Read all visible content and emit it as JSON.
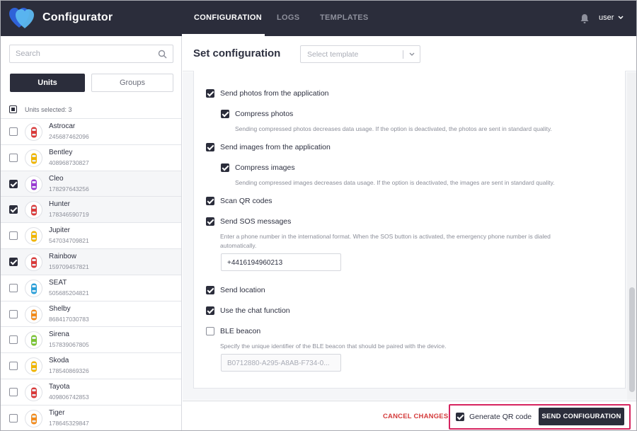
{
  "header": {
    "app_title": "Configurator",
    "tabs": [
      {
        "label": "CONFIGURATION",
        "active": true
      },
      {
        "label": "LOGS",
        "active": false
      },
      {
        "label": "TEMPLATES",
        "active": false
      }
    ],
    "user": "user",
    "icons": {
      "logo": "heart-logo-icon",
      "notifications": "bell-icon",
      "user_menu": "chevron-down-icon"
    },
    "colors": {
      "bar": "#2b2d3b",
      "logo_primary": "#2f62d8",
      "logo_secondary": "#5cb8f0"
    }
  },
  "sidebar": {
    "search_placeholder": "Search",
    "segments": {
      "units": "Units",
      "groups": "Groups",
      "active": "units"
    },
    "units_selected": "Units selected: 3",
    "units": [
      {
        "name": "Astrocar",
        "id": "245687462096",
        "checked": false,
        "color": "#d93a3a"
      },
      {
        "name": "Bentley",
        "id": "408968730827",
        "checked": false,
        "color": "#f0b400"
      },
      {
        "name": "Cleo",
        "id": "178297643256",
        "checked": true,
        "color": "#9b3bd1"
      },
      {
        "name": "Hunter",
        "id": "178346590719",
        "checked": true,
        "color": "#d93a3a"
      },
      {
        "name": "Jupiter",
        "id": "547034709821",
        "checked": false,
        "color": "#f0b400"
      },
      {
        "name": "Rainbow",
        "id": "159709457821",
        "checked": true,
        "color": "#d93a3a"
      },
      {
        "name": "SEAT",
        "id": "505685204821",
        "checked": false,
        "color": "#2a9fd8"
      },
      {
        "name": "Shelby",
        "id": "868417030783",
        "checked": false,
        "color": "#f28a1c"
      },
      {
        "name": "Sirena",
        "id": "157839067805",
        "checked": false,
        "color": "#7bc232"
      },
      {
        "name": "Skoda",
        "id": "178540869326",
        "checked": false,
        "color": "#f0b400"
      },
      {
        "name": "Tayota",
        "id": "409806742853",
        "checked": false,
        "color": "#d93a3a"
      },
      {
        "name": "Tiger",
        "id": "178645329847",
        "checked": false,
        "color": "#f28a1c"
      }
    ]
  },
  "main": {
    "title": "Set configuration",
    "template_placeholder": "Select template",
    "options": {
      "send_photos": {
        "label": "Send photos from the application",
        "checked": true
      },
      "compress_photos": {
        "label": "Compress photos",
        "checked": true,
        "description": "Sending compressed photos decreases data usage. If the option is deactivated, the photos are sent in standard quality."
      },
      "send_images": {
        "label": "Send images from the application",
        "checked": true
      },
      "compress_images": {
        "label": "Compress images",
        "checked": true,
        "description": "Sending compressed images decreases data usage. If the option is deactivated, the images are sent in standard quality."
      },
      "scan_qr": {
        "label": "Scan QR codes",
        "checked": true
      },
      "sos": {
        "label": "Send SOS messages",
        "checked": true,
        "description_line1": "Enter a phone number in the international format. When the SOS button is activated, the emergency phone number is dialed",
        "description_line2": "automatically.",
        "phone_value": "+4416194960213"
      },
      "send_location": {
        "label": "Send location",
        "checked": true
      },
      "chat": {
        "label": "Use the chat function",
        "checked": true
      },
      "ble": {
        "label": "BLE beacon",
        "checked": false,
        "description": "Specify the unique identifier of the BLE beacon that should be paired with the device.",
        "field_value": "B0712880-A295-A8AB-F734-0..."
      }
    }
  },
  "footer": {
    "cancel_label": "CANCEL CHANGES",
    "qr_label": "Generate QR code",
    "qr_checked": true,
    "send_label": "SEND CONFIGURATION",
    "colors": {
      "cancel": "#d43b3b",
      "highlight": "#d6245f"
    }
  }
}
